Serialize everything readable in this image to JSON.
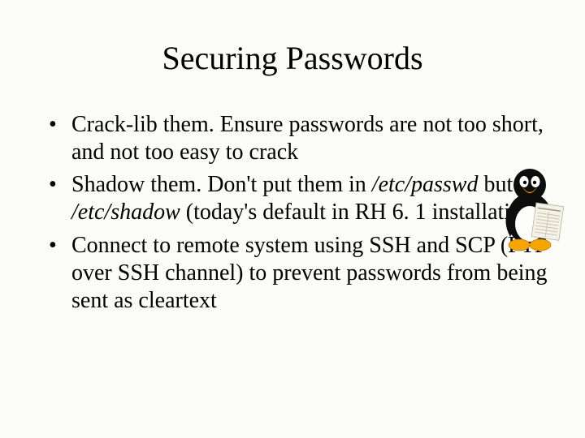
{
  "title": "Securing Passwords",
  "bullets": [
    {
      "pre": "Crack-lib them. Ensure passwords are not too short, and not too easy to crack",
      "it1": "",
      "mid": "",
      "it2": "",
      "post": ""
    },
    {
      "pre": "Shadow them. Don't put them in ",
      "it1": "/etc/passwd",
      "mid": " but in ",
      "it2": "/etc/shadow",
      "post": " (today's default in RH 6. 1 installation("
    },
    {
      "pre": "Connect to remote system using SSH and SCP (FTP over SSH channel) to prevent passwords from being sent as cleartext",
      "it1": "",
      "mid": "",
      "it2": "",
      "post": ""
    }
  ],
  "icon": "tux-reading-icon"
}
